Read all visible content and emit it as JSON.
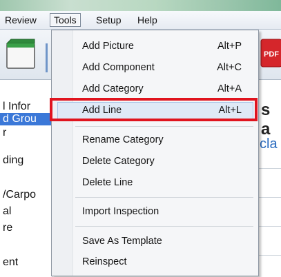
{
  "menubar": {
    "items": [
      {
        "label": "Review"
      },
      {
        "label": "Tools"
      },
      {
        "label": "Setup"
      },
      {
        "label": "Help"
      }
    ]
  },
  "toolbar": {
    "pdf_label": "PDF"
  },
  "tree": {
    "items": [
      {
        "label": "l Infor"
      },
      {
        "label": "d Grou"
      },
      {
        "label": "r"
      },
      {
        "label": "ding"
      },
      {
        "label": "/Carpo"
      },
      {
        "label": "al"
      },
      {
        "label": "re"
      },
      {
        "label": "ent"
      }
    ]
  },
  "content": {
    "heading_fragment": "s a",
    "link_fragment": "cla"
  },
  "tools_menu": {
    "items": [
      {
        "label": "Add Picture",
        "shortcut": "Alt+P"
      },
      {
        "label": "Add Component",
        "shortcut": "Alt+C"
      },
      {
        "label": "Add Category",
        "shortcut": "Alt+A"
      },
      {
        "label": "Add Line",
        "shortcut": "Alt+L"
      },
      {
        "label": "Rename Category",
        "shortcut": ""
      },
      {
        "label": "Delete Category",
        "shortcut": ""
      },
      {
        "label": "Delete Line",
        "shortcut": ""
      },
      {
        "label": "Import Inspection",
        "shortcut": ""
      },
      {
        "label": "Save As Template",
        "shortcut": ""
      },
      {
        "label": "Reinspect",
        "shortcut": ""
      }
    ],
    "highlighted_item": "Add Line",
    "highlight_color": "#e0141e"
  }
}
